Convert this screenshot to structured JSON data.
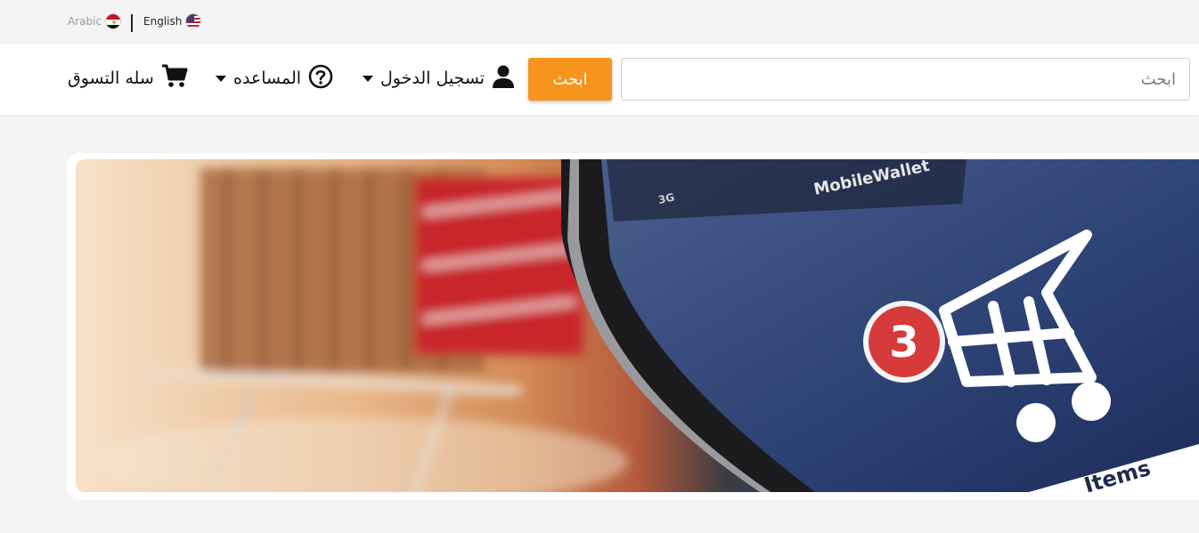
{
  "language_bar": {
    "arabic_label": "Arabic",
    "english_label": "English"
  },
  "navbar": {
    "search_placeholder": "ابحث",
    "search_button": "ابحث",
    "login_label": "تسجيل الدخول",
    "help_label": "المساعده",
    "cart_label": "سله التسوق",
    "accent_color": "#f7941d"
  },
  "banner": {
    "phone_brand_text": "MobileWallet",
    "signal_text": "3G",
    "cart_badge_count": "3",
    "items_label": "Items"
  },
  "icons": [
    "egypt-flag-icon",
    "us-flag-icon",
    "user-icon",
    "help-circle-icon",
    "shopping-cart-icon",
    "caret-down-icon"
  ]
}
